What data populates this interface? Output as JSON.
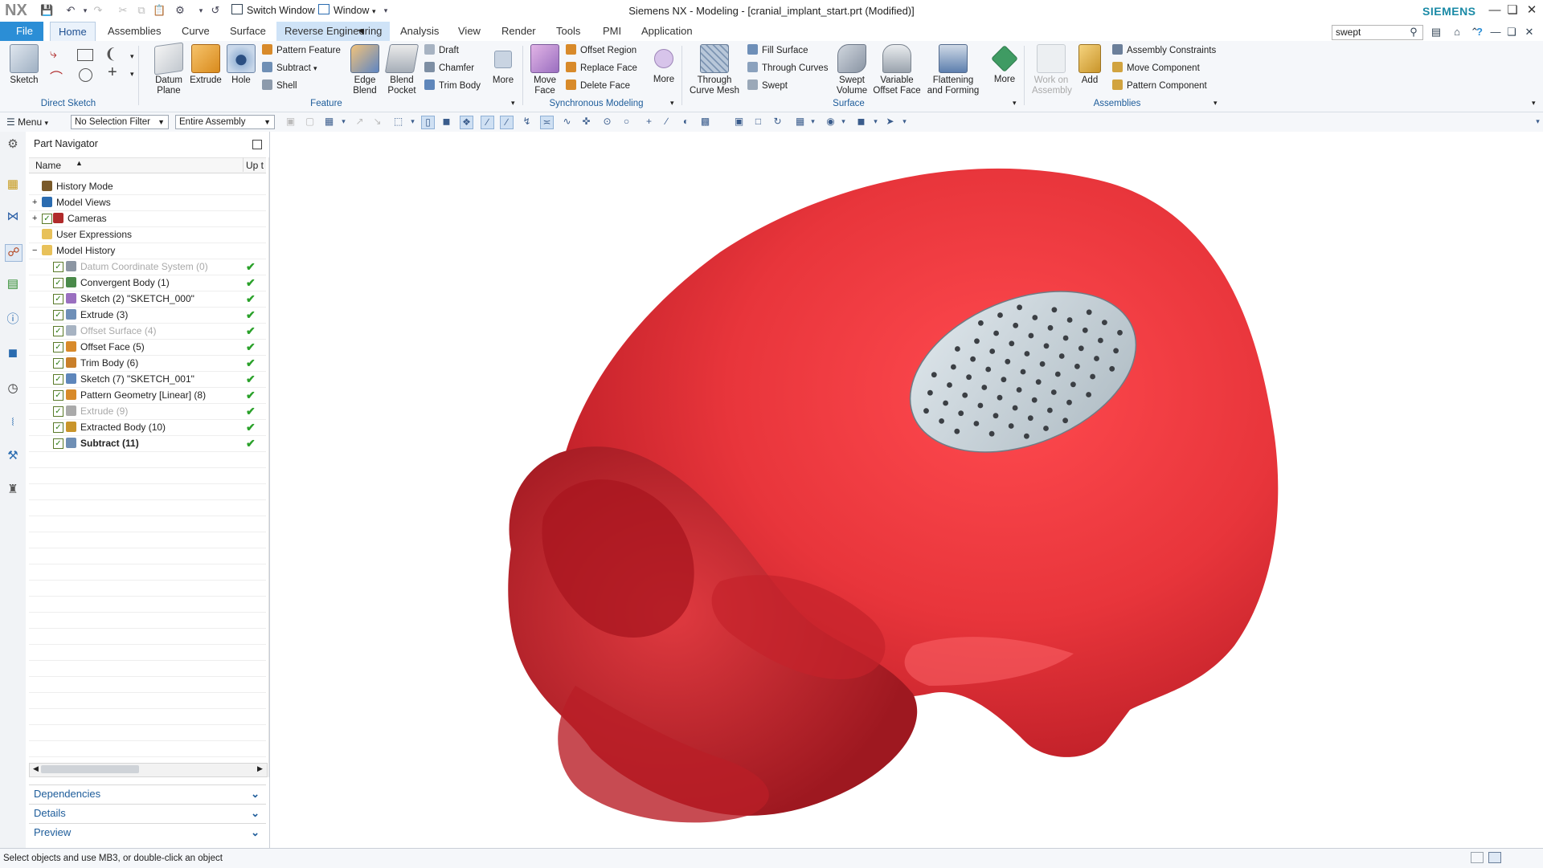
{
  "titlebar": {
    "logo": "NX",
    "switch_window": "Switch Window",
    "window_menu": "Window",
    "title": "Siemens NX - Modeling - [cranial_implant_start.prt (Modified)]",
    "brand": "SIEMENS"
  },
  "tabs": [
    "File",
    "Home",
    "Assemblies",
    "Curve",
    "Surface",
    "Reverse Engineering",
    "Analysis",
    "View",
    "Render",
    "Tools",
    "PMI",
    "Application"
  ],
  "search": {
    "value": "swept"
  },
  "ribbon": {
    "sketch": "Sketch",
    "direct_sketch": "Direct Sketch",
    "datum_plane": "Datum Plane",
    "extrude": "Extrude",
    "hole": "Hole",
    "pattern_feature": "Pattern Feature",
    "subtract": "Subtract",
    "shell": "Shell",
    "edge_blend": "Edge Blend",
    "blend_pocket": "Blend Pocket",
    "draft": "Draft",
    "chamfer": "Chamfer",
    "trim_body": "Trim Body",
    "more": "More",
    "feature": "Feature",
    "move_face": "Move Face",
    "offset_region": "Offset Region",
    "replace_face": "Replace Face",
    "delete_face": "Delete Face",
    "sync_modeling": "Synchronous Modeling",
    "through_curve_mesh": "Through Curve Mesh",
    "fill_surface": "Fill Surface",
    "through_curves": "Through Curves",
    "swept": "Swept",
    "swept_volume": "Swept Volume",
    "variable_offset_face": "Variable Offset Face",
    "flattening_forming": "Flattening and Forming",
    "surface": "Surface",
    "work_on_assembly": "Work on Assembly",
    "add": "Add",
    "assembly_constraints": "Assembly Constraints",
    "move_component": "Move Component",
    "pattern_component": "Pattern Component",
    "assemblies": "Assemblies"
  },
  "selbar": {
    "menu": "Menu",
    "filter": "No Selection Filter",
    "scope": "Entire Assembly"
  },
  "navigator": {
    "title": "Part Navigator",
    "col_name": "Name",
    "col_up": "Up t",
    "rows": [
      {
        "label": "History Mode",
        "indent": 0
      },
      {
        "label": "Model Views",
        "indent": 0
      },
      {
        "label": "Cameras",
        "indent": 0
      },
      {
        "label": "User Expressions",
        "indent": 0
      },
      {
        "label": "Model History",
        "indent": 0
      },
      {
        "label": "Datum Coordinate System (0)",
        "indent": 1,
        "dim": true
      },
      {
        "label": "Convergent Body (1)",
        "indent": 1
      },
      {
        "label": "Sketch (2) \"SKETCH_000\"",
        "indent": 1
      },
      {
        "label": "Extrude (3)",
        "indent": 1
      },
      {
        "label": "Offset Surface (4)",
        "indent": 1,
        "dim": true
      },
      {
        "label": "Offset Face (5)",
        "indent": 1
      },
      {
        "label": "Trim Body (6)",
        "indent": 1
      },
      {
        "label": "Sketch (7) \"SKETCH_001\"",
        "indent": 1
      },
      {
        "label": "Pattern Geometry [Linear] (8)",
        "indent": 1
      },
      {
        "label": "Extrude (9)",
        "indent": 1,
        "dim": true
      },
      {
        "label": "Extracted Body (10)",
        "indent": 1
      },
      {
        "label": "Subtract (11)",
        "indent": 1,
        "bold": true
      }
    ],
    "panels": [
      "Dependencies",
      "Details",
      "Preview"
    ]
  },
  "status": {
    "text": "Select objects and use MB3, or double-click an object"
  },
  "colors": {
    "skull": "#e8353b",
    "implant": "#c9d4da",
    "accent": "#2b8ed6"
  }
}
